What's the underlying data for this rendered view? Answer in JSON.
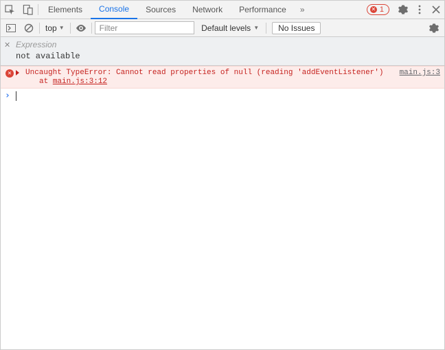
{
  "header": {
    "tabs": [
      "Elements",
      "Console",
      "Sources",
      "Network",
      "Performance"
    ],
    "active_tab": "Console",
    "overflow_label": "»",
    "error_count": "1"
  },
  "toolbar": {
    "context": "top",
    "filter_placeholder": "Filter",
    "levels_label": "Default levels",
    "issues_label": "No Issues"
  },
  "live_expression": {
    "label": "Expression",
    "value": "not available"
  },
  "error": {
    "message": "Uncaught TypeError: Cannot read properties of null (reading 'addEventListener')",
    "source_link": "main.js:3",
    "stack_prefix": "at ",
    "stack_location": "main.js:3:12"
  },
  "prompt": {
    "chevron": "›"
  }
}
